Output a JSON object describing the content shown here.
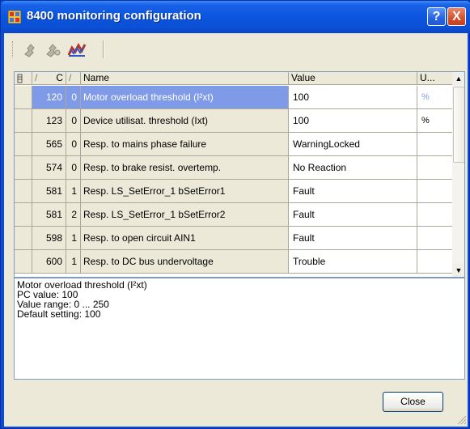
{
  "window": {
    "title": "8400 monitoring configuration",
    "help_glyph": "?",
    "close_glyph": "X"
  },
  "toolbar": {
    "buttons": [
      "pin-icon",
      "pin-edit-icon",
      "monitor-config-icon"
    ]
  },
  "grid": {
    "headers": {
      "code_sort": "/",
      "code": "C",
      "sub_sort": "/",
      "name": "Name",
      "value": "Value",
      "unit": "U..."
    },
    "rows": [
      {
        "code": "120",
        "sub": "0",
        "name": "Motor overload threshold (I²xt)",
        "value": "100",
        "unit": "%",
        "selected": true
      },
      {
        "code": "123",
        "sub": "0",
        "name": "Device utilisat. threshold (Ixt)",
        "value": "100",
        "unit": "%",
        "selected": false
      },
      {
        "code": "565",
        "sub": "0",
        "name": "Resp. to mains phase failure",
        "value": "WarningLocked",
        "unit": "",
        "selected": false
      },
      {
        "code": "574",
        "sub": "0",
        "name": "Resp. to brake resist. overtemp.",
        "value": "No Reaction",
        "unit": "",
        "selected": false
      },
      {
        "code": "581",
        "sub": "1",
        "name": "Resp. LS_SetError_1 bSetError1",
        "value": "Fault",
        "unit": "",
        "selected": false
      },
      {
        "code": "581",
        "sub": "2",
        "name": "Resp. LS_SetError_1 bSetError2",
        "value": "Fault",
        "unit": "",
        "selected": false
      },
      {
        "code": "598",
        "sub": "1",
        "name": "Resp. to open circuit AIN1",
        "value": "Fault",
        "unit": "",
        "selected": false
      },
      {
        "code": "600",
        "sub": "1",
        "name": "Resp. to DC bus undervoltage",
        "value": "Trouble",
        "unit": "",
        "selected": false
      }
    ],
    "scroll_up": "▲",
    "scroll_down": "▼"
  },
  "description": {
    "lines": [
      "Motor overload threshold (I²xt)",
      "PC value: 100",
      "Value range: 0 ... 250",
      "Default setting: 100"
    ]
  },
  "footer": {
    "close_label": "Close"
  },
  "colors": {
    "titlebar": "#0a55df",
    "selection": "#7f9be8",
    "face": "#ece9d8"
  }
}
